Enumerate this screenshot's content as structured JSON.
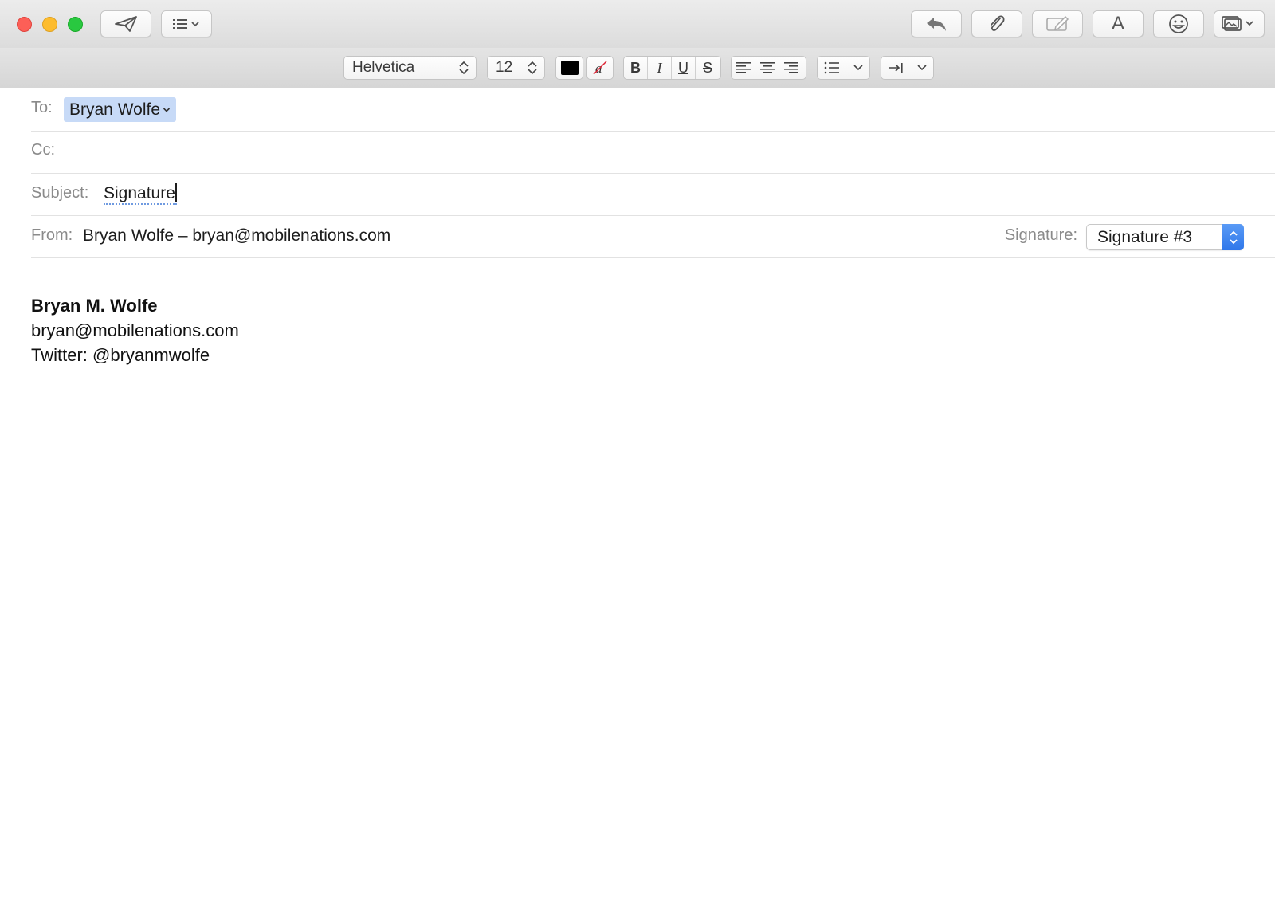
{
  "window": {
    "traffic_lights": [
      "close",
      "minimize",
      "zoom"
    ]
  },
  "toolbar": {
    "buttons": [
      {
        "name": "send-icon"
      },
      {
        "name": "header-fields-icon"
      },
      {
        "name": "reply-icon"
      },
      {
        "name": "attach-icon"
      },
      {
        "name": "markup-icon"
      },
      {
        "name": "format-icon",
        "glyph": "A"
      },
      {
        "name": "emoji-icon"
      },
      {
        "name": "photo-browser-icon"
      }
    ]
  },
  "format_bar": {
    "font": "Helvetica",
    "size": "12",
    "text_color": "#000000",
    "style_buttons": [
      "B",
      "I",
      "U",
      "S"
    ],
    "alignment": [
      "align-left",
      "align-center",
      "align-right"
    ],
    "list_icon": "list-icon",
    "indent_icon": "indent-icon"
  },
  "header": {
    "to_label": "To:",
    "to_value": "Bryan Wolfe",
    "cc_label": "Cc:",
    "subject_label": "Subject:",
    "subject_value": "Signature",
    "from_label": "From:",
    "from_value": "Bryan Wolfe – bryan@mobilenations.com",
    "signature_label": "Signature:",
    "signature_value": "Signature #3"
  },
  "body": {
    "signature_name": "Bryan M. Wolfe",
    "signature_email": "bryan@mobilenations.com",
    "signature_twitter": "Twitter: @bryanmwolfe"
  },
  "colors": {
    "token_bg": "#c7daf7",
    "accent": "#2f77ea"
  }
}
